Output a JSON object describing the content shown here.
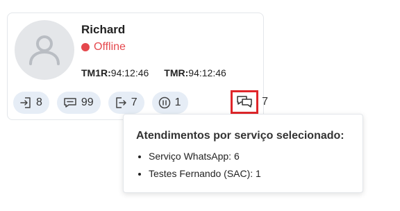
{
  "agent": {
    "name": "Richard",
    "status": "Offline",
    "status_color": "#e5484d",
    "timers": [
      {
        "label": "TM1R:",
        "value": "94:12:46"
      },
      {
        "label": "TMR:",
        "value": "94:12:46"
      }
    ]
  },
  "badges": [
    {
      "icon": "login-icon",
      "value": "8"
    },
    {
      "icon": "chat-icon",
      "value": "99"
    },
    {
      "icon": "logout-icon",
      "value": "7"
    },
    {
      "icon": "pause-icon",
      "value": "1"
    }
  ],
  "highlighted_badge": {
    "icon": "chat-bubbles-icon",
    "value": "7",
    "highlight_color": "#e0262a"
  },
  "tooltip": {
    "title": "Atendimentos por serviço selecionado:",
    "items": [
      "Serviço WhatsApp: 6",
      "Testes Fernando (SAC): 1"
    ]
  }
}
